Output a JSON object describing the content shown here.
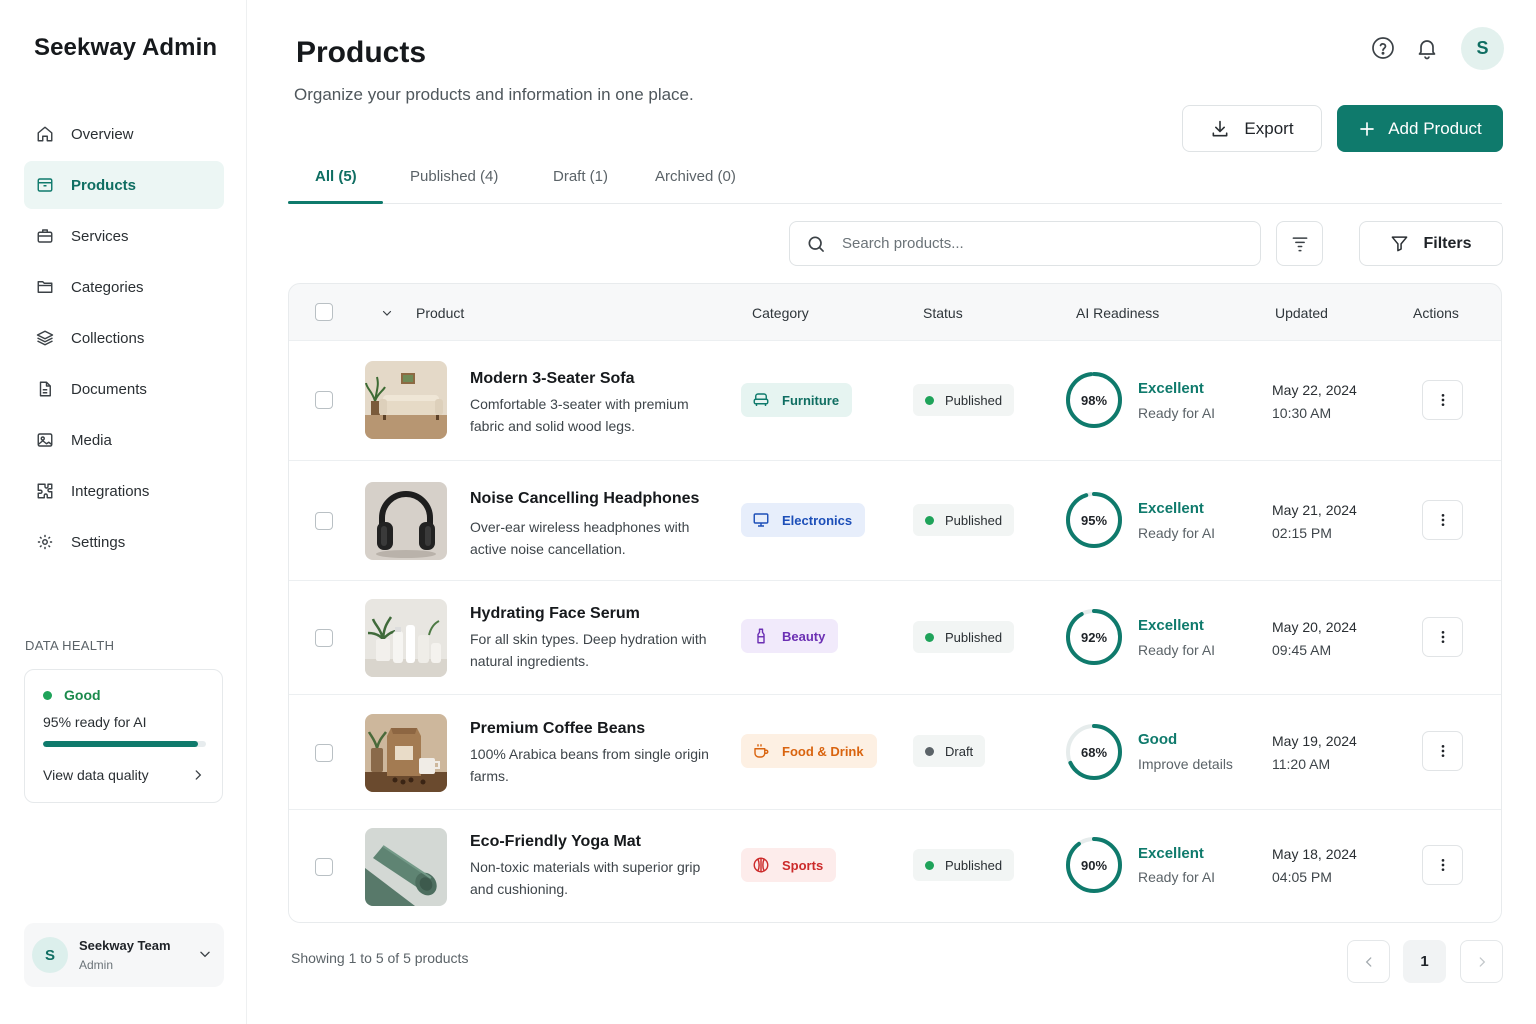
{
  "app": {
    "title": "Seekway Admin"
  },
  "sidebar": {
    "items": [
      {
        "label": "Overview",
        "icon": "home-icon"
      },
      {
        "label": "Products",
        "icon": "package-icon",
        "active": true
      },
      {
        "label": "Services",
        "icon": "briefcase-icon"
      },
      {
        "label": "Categories",
        "icon": "folder-icon"
      },
      {
        "label": "Collections",
        "icon": "layers-icon"
      },
      {
        "label": "Documents",
        "icon": "document-icon"
      },
      {
        "label": "Media",
        "icon": "image-icon"
      },
      {
        "label": "Integrations",
        "icon": "puzzle-icon"
      },
      {
        "label": "Settings",
        "icon": "gear-icon"
      }
    ],
    "data_health": {
      "title": "DATA HEALTH",
      "status": "Good",
      "ready_text": "95% ready for AI",
      "ready_fraction": 0.95,
      "link": "View data quality"
    },
    "team": {
      "initial": "S",
      "name": "Seekway Team",
      "role": "Admin"
    }
  },
  "header": {
    "title": "Products",
    "subtitle": "Organize your products and information in one place.",
    "avatar_initial": "S",
    "export_label": "Export",
    "add_label": "Add Product"
  },
  "tabs": [
    {
      "label": "All (5)",
      "active": true
    },
    {
      "label": "Published (4)"
    },
    {
      "label": "Draft (1)"
    },
    {
      "label": "Archived (0)"
    }
  ],
  "search": {
    "placeholder": "Search products..."
  },
  "filters_label": "Filters",
  "table": {
    "columns": {
      "product": "Product",
      "category": "Category",
      "status": "Status",
      "ai": "AI Readiness",
      "updated": "Updated",
      "actions": "Actions"
    },
    "rows": [
      {
        "name": "Modern 3-Seater Sofa",
        "desc": "Comfortable 3-seater with premium fabric and solid wood legs.",
        "category": "Furniture",
        "status": "Published",
        "score": "98%",
        "score_value": 98,
        "grade": "Excellent",
        "note": "Ready for AI",
        "date": "May 22, 2024",
        "time": "10:30 AM"
      },
      {
        "name": "Noise Cancelling Headphones",
        "desc": "Over-ear wireless headphones with active noise cancellation.",
        "category": "Electronics",
        "status": "Published",
        "score": "95%",
        "score_value": 95,
        "grade": "Excellent",
        "note": "Ready for AI",
        "date": "May 21, 2024",
        "time": "02:15 PM"
      },
      {
        "name": "Hydrating Face Serum",
        "desc": "For all skin types. Deep hydration with natural ingredients.",
        "category": "Beauty",
        "status": "Published",
        "score": "92%",
        "score_value": 92,
        "grade": "Excellent",
        "note": "Ready for AI",
        "date": "May 20, 2024",
        "time": "09:45 AM"
      },
      {
        "name": "Premium Coffee Beans",
        "desc": "100% Arabica beans from single origin farms.",
        "category": "Food & Drink",
        "status": "Draft",
        "score": "68%",
        "score_value": 68,
        "grade": "Good",
        "note": "Improve details",
        "date": "May 19, 2024",
        "time": "11:20 AM"
      },
      {
        "name": "Eco-Friendly Yoga Mat",
        "desc": "Non-toxic materials with superior grip and cushioning.",
        "category": "Sports",
        "status": "Published",
        "score": "90%",
        "score_value": 90,
        "grade": "Excellent",
        "note": "Ready for AI",
        "date": "May 18, 2024",
        "time": "04:05 PM"
      }
    ]
  },
  "pagination": {
    "showing": "Showing 1 to 5 of 5 products",
    "current_page": "1"
  },
  "colors": {
    "accent": "#0f7a6c",
    "published": "#1fa35a",
    "draft": "#5b6368",
    "furniture": "#0f7a6c",
    "electronics": "#1d4fb8",
    "beauty": "#6b2fb3",
    "food": "#d9640f",
    "sports": "#cc2b2b"
  }
}
